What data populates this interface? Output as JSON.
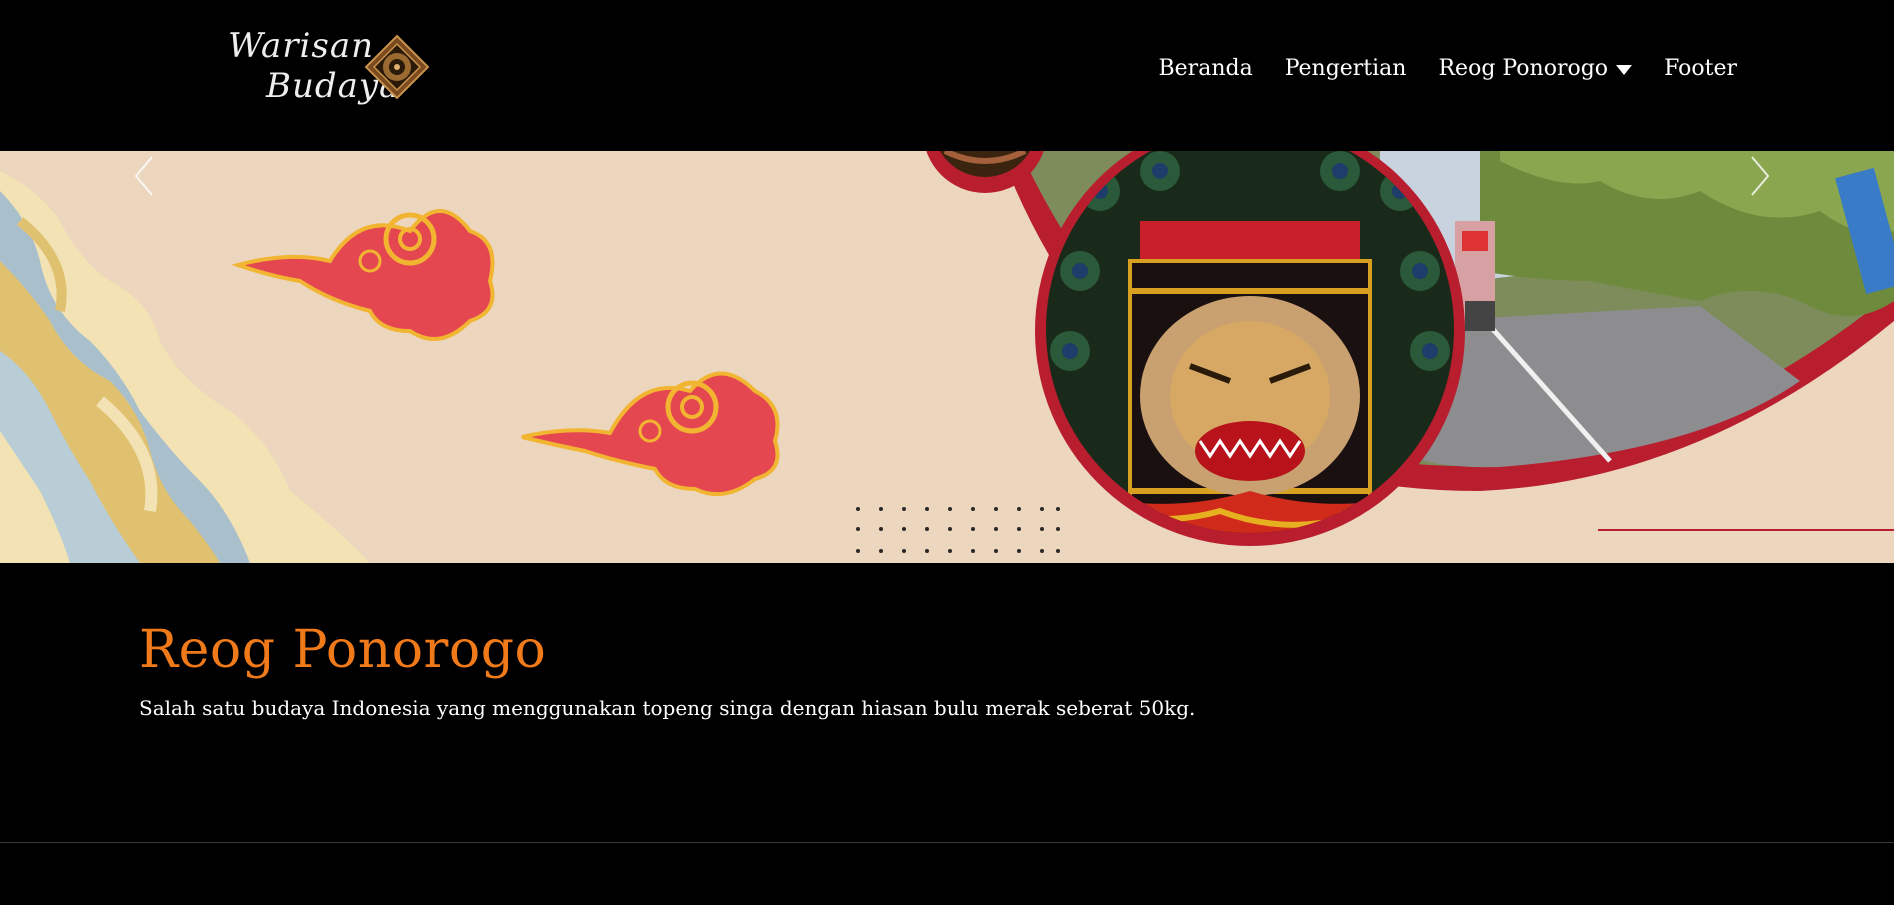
{
  "logo": {
    "line1": "Warisan",
    "line2": "Budaya"
  },
  "nav": {
    "items": [
      {
        "label": "Beranda"
      },
      {
        "label": "Pengertian"
      },
      {
        "label": "Reog Ponorogo"
      },
      {
        "label": "Footer"
      }
    ]
  },
  "hero": {
    "slider": "carousel"
  },
  "content": {
    "title": "Reog Ponorogo",
    "description": "Salah satu budaya Indonesia yang menggunakan topeng singa dengan hiasan bulu merak seberat 50kg."
  },
  "colors": {
    "accent": "#f07a1a",
    "hero_bg": "#ecd6bd",
    "frame_red": "#b81e2e",
    "cloud_red": "#e4474f",
    "cloud_outline": "#f2b531"
  }
}
